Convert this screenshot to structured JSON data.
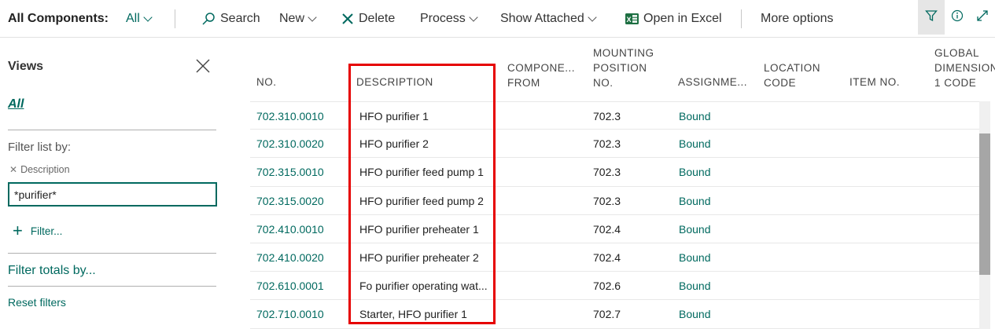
{
  "toolbar": {
    "title": "All Components:",
    "view_selector": "All",
    "search": "Search",
    "new": "New",
    "delete": "Delete",
    "process": "Process",
    "show_attached": "Show Attached",
    "open_in_excel": "Open in Excel",
    "more_options": "More options"
  },
  "views": {
    "title": "Views",
    "all_link": "All",
    "filter_list_by": "Filter list by:",
    "filter_field": "Description",
    "filter_value": "*purifier*",
    "add_filter": "Filter...",
    "filter_totals_by": "Filter totals by...",
    "reset_filters": "Reset filters"
  },
  "grid": {
    "headers": {
      "no": "NO.",
      "description": "DESCRIPTION",
      "component_from": [
        "COMPONE...",
        "FROM"
      ],
      "mounting_position": [
        "MOUNTING",
        "POSITION",
        "NO."
      ],
      "assignment": "ASSIGNME...",
      "location_code": [
        "LOCATION",
        "CODE"
      ],
      "item_no": "ITEM NO.",
      "global_dimension": [
        "GLOBAL",
        "DIMENSION",
        "1 CODE"
      ]
    },
    "rows": [
      {
        "no": "702.310.0010",
        "description": "HFO purifier 1",
        "mounting_position": "702.3",
        "assignment": "Bound"
      },
      {
        "no": "702.310.0020",
        "description": "HFO purifier 2",
        "mounting_position": "702.3",
        "assignment": "Bound"
      },
      {
        "no": "702.315.0010",
        "description": "HFO purifier feed pump 1",
        "mounting_position": "702.3",
        "assignment": "Bound"
      },
      {
        "no": "702.315.0020",
        "description": "HFO purifier feed pump 2",
        "mounting_position": "702.3",
        "assignment": "Bound"
      },
      {
        "no": "702.410.0010",
        "description": "HFO purifier preheater 1",
        "mounting_position": "702.4",
        "assignment": "Bound"
      },
      {
        "no": "702.410.0020",
        "description": "HFO purifier preheater 2",
        "mounting_position": "702.4",
        "assignment": "Bound"
      },
      {
        "no": "702.610.0001",
        "description": "Fo purifier operating wat...",
        "mounting_position": "702.6",
        "assignment": "Bound"
      },
      {
        "no": "702.710.0010",
        "description": "Starter, HFO purifier 1",
        "mounting_position": "702.7",
        "assignment": "Bound"
      }
    ]
  },
  "colors": {
    "accent": "#00695f",
    "highlight": "#e60000"
  }
}
